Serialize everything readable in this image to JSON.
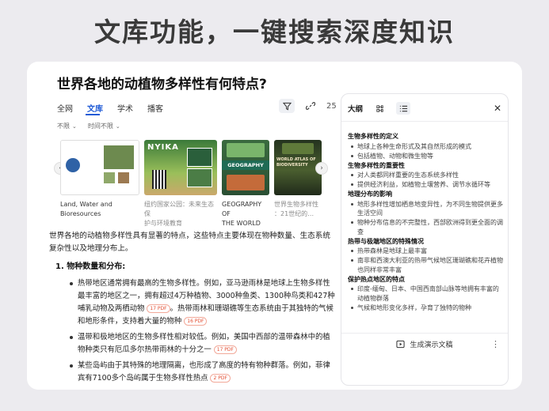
{
  "banner": {
    "title": "文库功能，一键搜索深度知识"
  },
  "question": {
    "title": "世界各地的动植物多样性有何特点?"
  },
  "tabs": [
    {
      "label": "全网"
    },
    {
      "label": "文库"
    },
    {
      "label": "学术"
    },
    {
      "label": "播客"
    }
  ],
  "toolbar": {
    "link_count": "25"
  },
  "filters": {
    "f1": "不限",
    "f2": "时间不限"
  },
  "carousel": {
    "items": [
      {
        "cap1": "Land, Water and",
        "cap2": "Bioresources",
        "gray": false
      },
      {
        "cap1": "纽约国家公园：未来生态保",
        "cap2": "护与环境教育",
        "gray": true,
        "cover_text": "NYIKA"
      },
      {
        "cap1": "GEOGRAPHY OF",
        "cap2": "THE WORLD",
        "gray": false,
        "cover_text": "GEOGRAPHY"
      },
      {
        "cap1": "世界生物多样性",
        "cap2": "：21世纪的…",
        "gray": true,
        "cover_text": "WORLD ATLAS OF BIODIVERSITY"
      }
    ]
  },
  "content": {
    "intro": "世界各地的动植物多样性具有显著的特点，这些特点主要体现在物种数量、生态系统复杂性以及地理分布上。",
    "section1": "1. 物种数量和分布:",
    "b1": "热带地区通常拥有最高的生物多样性。例如，亚马逊雨林是地球上生物多样性最丰富的地区之一，拥有超过4万种植物、3000种鱼类、1300种鸟类和427种哺乳动物及两栖动物",
    "b1_pdf1": "17 PDF",
    "b1b": "。热带雨林和珊瑚礁等生态系统由于其独特的气候和地形条件，支持着大量的物种",
    "b1_pdf2": "16 PDF",
    "b2": "温带和极地地区的生物多样性相对较低。例如，美国中西部的温带森林中的植物种类只有厄瓜多尔热带雨林的十分之一",
    "b2_pdf": "17 PDF",
    "b3": "某些岛屿由于其特殊的地理隔离，也形成了高度的特有物种群落。例如，菲律宾有7100多个岛屿属于生物多样性热点",
    "b3_pdf": "2 PDF"
  },
  "side": {
    "title": "大纲",
    "close": "✕",
    "outline": [
      {
        "h": "生物多样性的定义",
        "items": [
          "地球上各种生命形式及其自然形成的模式",
          "包括植物、动物和微生物等"
        ]
      },
      {
        "h": "生物多样性的重要性",
        "items": [
          "对人类都同样重要的生态系统多样性",
          "提供经济利益，如植物土壤营养、调节水循环等"
        ]
      },
      {
        "h": "地理分布的影响",
        "items": [
          "地形多样性增加栖息地变异性，为不同生物提供更多生活空间",
          "物种分布信息的不完整性，西部欧洲得到更全面的调查"
        ]
      },
      {
        "h": "热带与极端地区的特殊情况",
        "items": [
          "热带森林是地球上最丰富",
          "南非和西澳大利亚的热带气候地区珊瑚礁和花卉植物也同样非常丰富"
        ]
      },
      {
        "h": "保护热点地区的特点",
        "items": [
          "印度-缅甸、日本、中国西南部山脉等地拥有丰富的动植物群落",
          "气候和地形变化多样，孕育了独特的物种"
        ]
      }
    ],
    "footer": "生成演示文稿",
    "more": "⋮"
  },
  "colors": {
    "accent": "#1f5bd6",
    "pdf_badge": "#e34b2f"
  }
}
